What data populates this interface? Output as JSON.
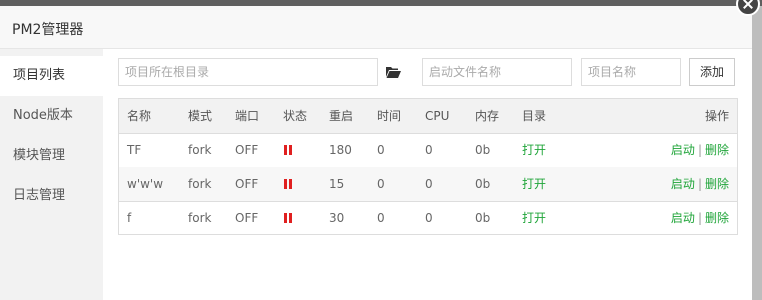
{
  "modal": {
    "title": "PM2管理器"
  },
  "sidebar": {
    "items": [
      {
        "label": "项目列表"
      },
      {
        "label": "Node版本"
      },
      {
        "label": "模块管理"
      },
      {
        "label": "日志管理"
      }
    ]
  },
  "form": {
    "path_placeholder": "项目所在根目录",
    "startfile_placeholder": "启动文件名称",
    "name_placeholder": "项目名称",
    "add_label": "添加"
  },
  "table": {
    "headers": {
      "name": "名称",
      "mode": "模式",
      "port": "端口",
      "status": "状态",
      "restart": "重启",
      "time": "时间",
      "cpu": "CPU",
      "mem": "内存",
      "dir": "目录",
      "ops": "操作"
    },
    "rows": [
      {
        "name": "TF",
        "mode": "fork",
        "port": "OFF",
        "status": "paused",
        "restart": "180",
        "time": "0",
        "cpu": "0",
        "mem": "0b",
        "dir": "打开",
        "start": "启动",
        "sep": "|",
        "delete": "删除"
      },
      {
        "name": "w'w'w",
        "mode": "fork",
        "port": "OFF",
        "status": "paused",
        "restart": "15",
        "time": "0",
        "cpu": "0",
        "mem": "0b",
        "dir": "打开",
        "start": "启动",
        "sep": "|",
        "delete": "删除"
      },
      {
        "name": "f",
        "mode": "fork",
        "port": "OFF",
        "status": "paused",
        "restart": "30",
        "time": "0",
        "cpu": "0",
        "mem": "0b",
        "dir": "打开",
        "start": "启动",
        "sep": "|",
        "delete": "删除"
      }
    ]
  },
  "colors": {
    "link": "#20a53a",
    "status_paused": "#e02020"
  }
}
